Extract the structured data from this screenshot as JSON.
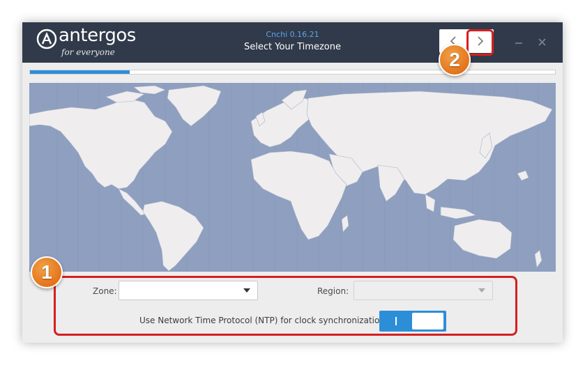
{
  "header": {
    "logo_name": "antergos",
    "logo_tagline": "for everyone",
    "app_title": "Cnchi  0.16.21",
    "page_title": "Select Your Timezone"
  },
  "nav": {
    "back_glyph": "‹",
    "forward_glyph": "›"
  },
  "window_controls": {
    "minimize_icon": "minimize-icon",
    "close_icon": "close-icon"
  },
  "progress": {
    "value": 0.19
  },
  "timezone": {
    "zone_label": "Zone:",
    "zone_value": "",
    "region_label": "Region:",
    "region_value": "",
    "region_enabled": false
  },
  "ntp": {
    "label": "Use Network Time Protocol (NTP) for clock synchronization",
    "enabled": true
  },
  "annotations": {
    "badge_1": "1",
    "badge_2": "2",
    "color": "#d42020"
  },
  "colors": {
    "header_bg": "#303a4a",
    "accent": "#2d8ed8",
    "ocean": "#8e9fbf",
    "land": "#efedee"
  }
}
